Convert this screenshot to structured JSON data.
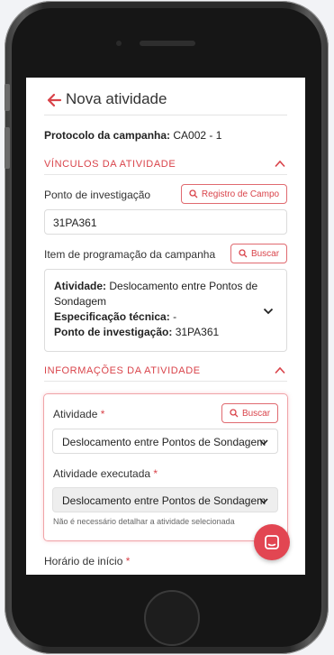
{
  "header": {
    "title": "Nova atividade"
  },
  "protocol": {
    "label": "Protocolo da campanha:",
    "value": "CA002 - 1"
  },
  "sections": {
    "links_title": "VÍNCULOS DA ATIVIDADE",
    "info_title": "INFORMAÇÕES DA ATIVIDADE"
  },
  "investigation_point": {
    "label": "Ponto de investigação",
    "button_label": "Registro de Campo",
    "value": "31PA361"
  },
  "program_item": {
    "label": "Item de programação da campanha",
    "button_label": "Buscar",
    "card": {
      "activity_label": "Atividade:",
      "activity_value": "Deslocamento entre Pontos de Sondagem",
      "spec_label": "Especificação técnica:",
      "spec_value": "-",
      "point_label": "Ponto de investigação:",
      "point_value": "31PA361"
    }
  },
  "activity": {
    "label": "Atividade",
    "required_mark": "*",
    "button_label": "Buscar",
    "selected": "Deslocamento entre Pontos de Sondagem"
  },
  "executed_activity": {
    "label": "Atividade executada",
    "required_mark": "*",
    "selected": "Deslocamento entre Pontos de Sondagem",
    "hint": "Não é necessário detalhar a atividade selecionada"
  },
  "start_time": {
    "label": "Horário de início",
    "required_mark": "*"
  },
  "colors": {
    "accent": "#d9434a",
    "fab": "#e24652"
  },
  "icons": {
    "back": "arrow-left-icon",
    "search": "search-icon",
    "chevron": "chevron-icon",
    "chat": "chat-icon"
  }
}
